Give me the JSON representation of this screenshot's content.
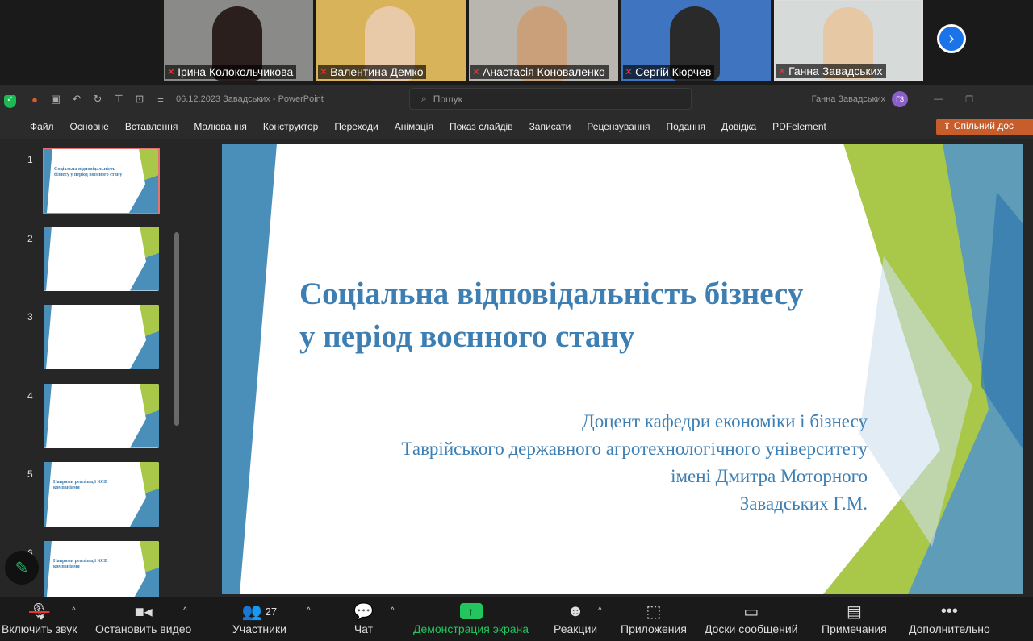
{
  "participants": [
    {
      "name": "Ірина Колокольчикова",
      "bg": "#8a8a88",
      "person": "#2a1f1c"
    },
    {
      "name": "Валентина Демко",
      "bg": "#d9b35a",
      "person": "#e8c9a8"
    },
    {
      "name": "Анастасія Коноваленко",
      "bg": "#b8b6ae",
      "person": "#c9a07a"
    },
    {
      "name": "Сергій Кюрчев",
      "bg": "#3f74c0",
      "person": "#2a2a2a"
    },
    {
      "name": "Ганна Завадських",
      "bg": "#d6dad8",
      "person": "#e6c8a4"
    }
  ],
  "ppt": {
    "doc_title": "06.12.2023 Завадських  -  PowerPoint",
    "search_placeholder": "Пошук",
    "user_name": "Ганна Завадських",
    "user_initials": "ГЗ",
    "ribbon_tabs": [
      "Файл",
      "Основне",
      "Вставлення",
      "Малювання",
      "Конструктор",
      "Переходи",
      "Анімація",
      "Показ слайдів",
      "Записати",
      "Рецензування",
      "Подання",
      "Довідка",
      "PDFelement"
    ],
    "share_label": "Спільний дос",
    "thumbnails": [
      {
        "num": "1",
        "title": "Соціальна відповідальність бізнесу у період воєнного стану"
      },
      {
        "num": "2",
        "title": ""
      },
      {
        "num": "3",
        "title": ""
      },
      {
        "num": "4",
        "title": ""
      },
      {
        "num": "5",
        "title": "Напрями реалізації КСВ компаніями"
      },
      {
        "num": "6",
        "title": "Напрями реалізації КСВ компаніями"
      }
    ],
    "slide": {
      "title_line1": "Соціальна відповідальність бізнесу",
      "title_line2": "у період воєнного стану",
      "sub1": "Доцент кафедри економіки і бізнесу",
      "sub2": "Таврійського державного агротехнологічного університету",
      "sub3": "імені Дмитра Моторного",
      "sub4": "Завадських Г.М."
    }
  },
  "toolbar": {
    "mute": "Включить звук",
    "video": "Остановить видео",
    "participants": "Участники",
    "participants_count": "27",
    "chat": "Чат",
    "share": "Демонстрация экрана",
    "reactions": "Реакции",
    "apps": "Приложения",
    "whiteboards": "Доски сообщений",
    "notes": "Примечания",
    "more": "Дополнительно"
  },
  "colors": {
    "accent_blue": "#3d7fb3",
    "share_green": "#22c55e",
    "share_orange": "#c65d2b"
  }
}
